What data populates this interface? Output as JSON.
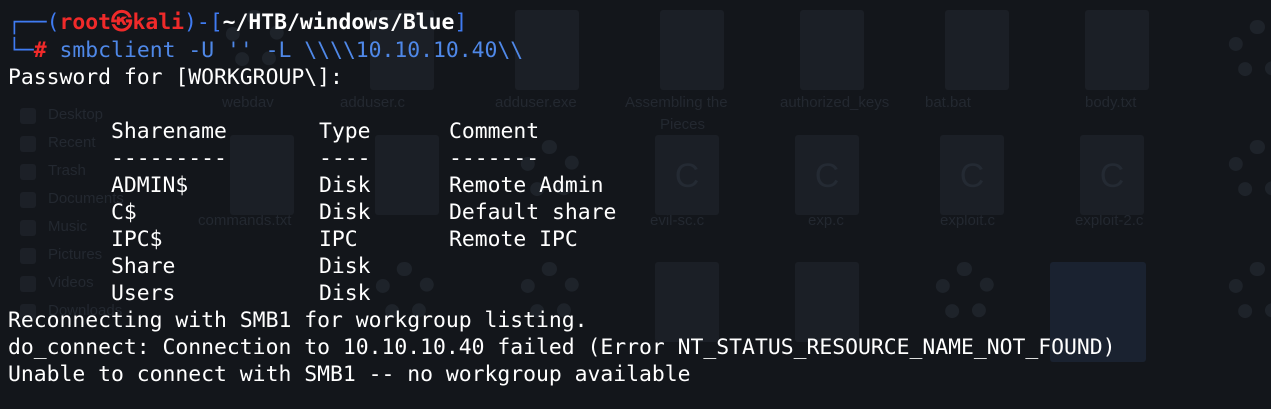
{
  "prompt": {
    "user": "root",
    "skull": "㉿",
    "host": "kali",
    "path": "~/HTB/windows/Blue",
    "symbol": "#"
  },
  "command": {
    "program": "smbclient",
    "args": "-U '' -L \\\\\\\\10.10.10.40\\\\"
  },
  "password_prompt": "Password for [WORKGROUP\\]:",
  "shares": {
    "headers": [
      "Sharename",
      "Type",
      "Comment"
    ],
    "separators": [
      "---------",
      "----",
      "-------"
    ],
    "rows": [
      {
        "name": "ADMIN$",
        "type": "Disk",
        "comment": "Remote Admin"
      },
      {
        "name": "C$",
        "type": "Disk",
        "comment": "Default share"
      },
      {
        "name": "IPC$",
        "type": "IPC",
        "comment": "Remote IPC"
      },
      {
        "name": "Share",
        "type": "Disk",
        "comment": ""
      },
      {
        "name": "Users",
        "type": "Disk",
        "comment": ""
      }
    ]
  },
  "output_lines": [
    "Reconnecting with SMB1 for workgroup listing.",
    "do_connect: Connection to 10.10.10.40 failed (Error NT_STATUS_RESOURCE_NAME_NOT_FOUND)",
    "Unable to connect with SMB1 -- no workgroup available"
  ],
  "background": {
    "labels": [
      "webdav",
      "adduser.c",
      "adduser.exe",
      "Assembling the",
      "Pieces",
      "authorized_keys",
      "bat.bat",
      "body.txt",
      "Desktop",
      "Recent",
      "Trash",
      "Documents",
      "Music",
      "Pictures",
      "Videos",
      "Downloads",
      "commands.txt",
      "evil-sc.c",
      "exp.c",
      "exploit.c",
      "exploit-2.c"
    ]
  }
}
